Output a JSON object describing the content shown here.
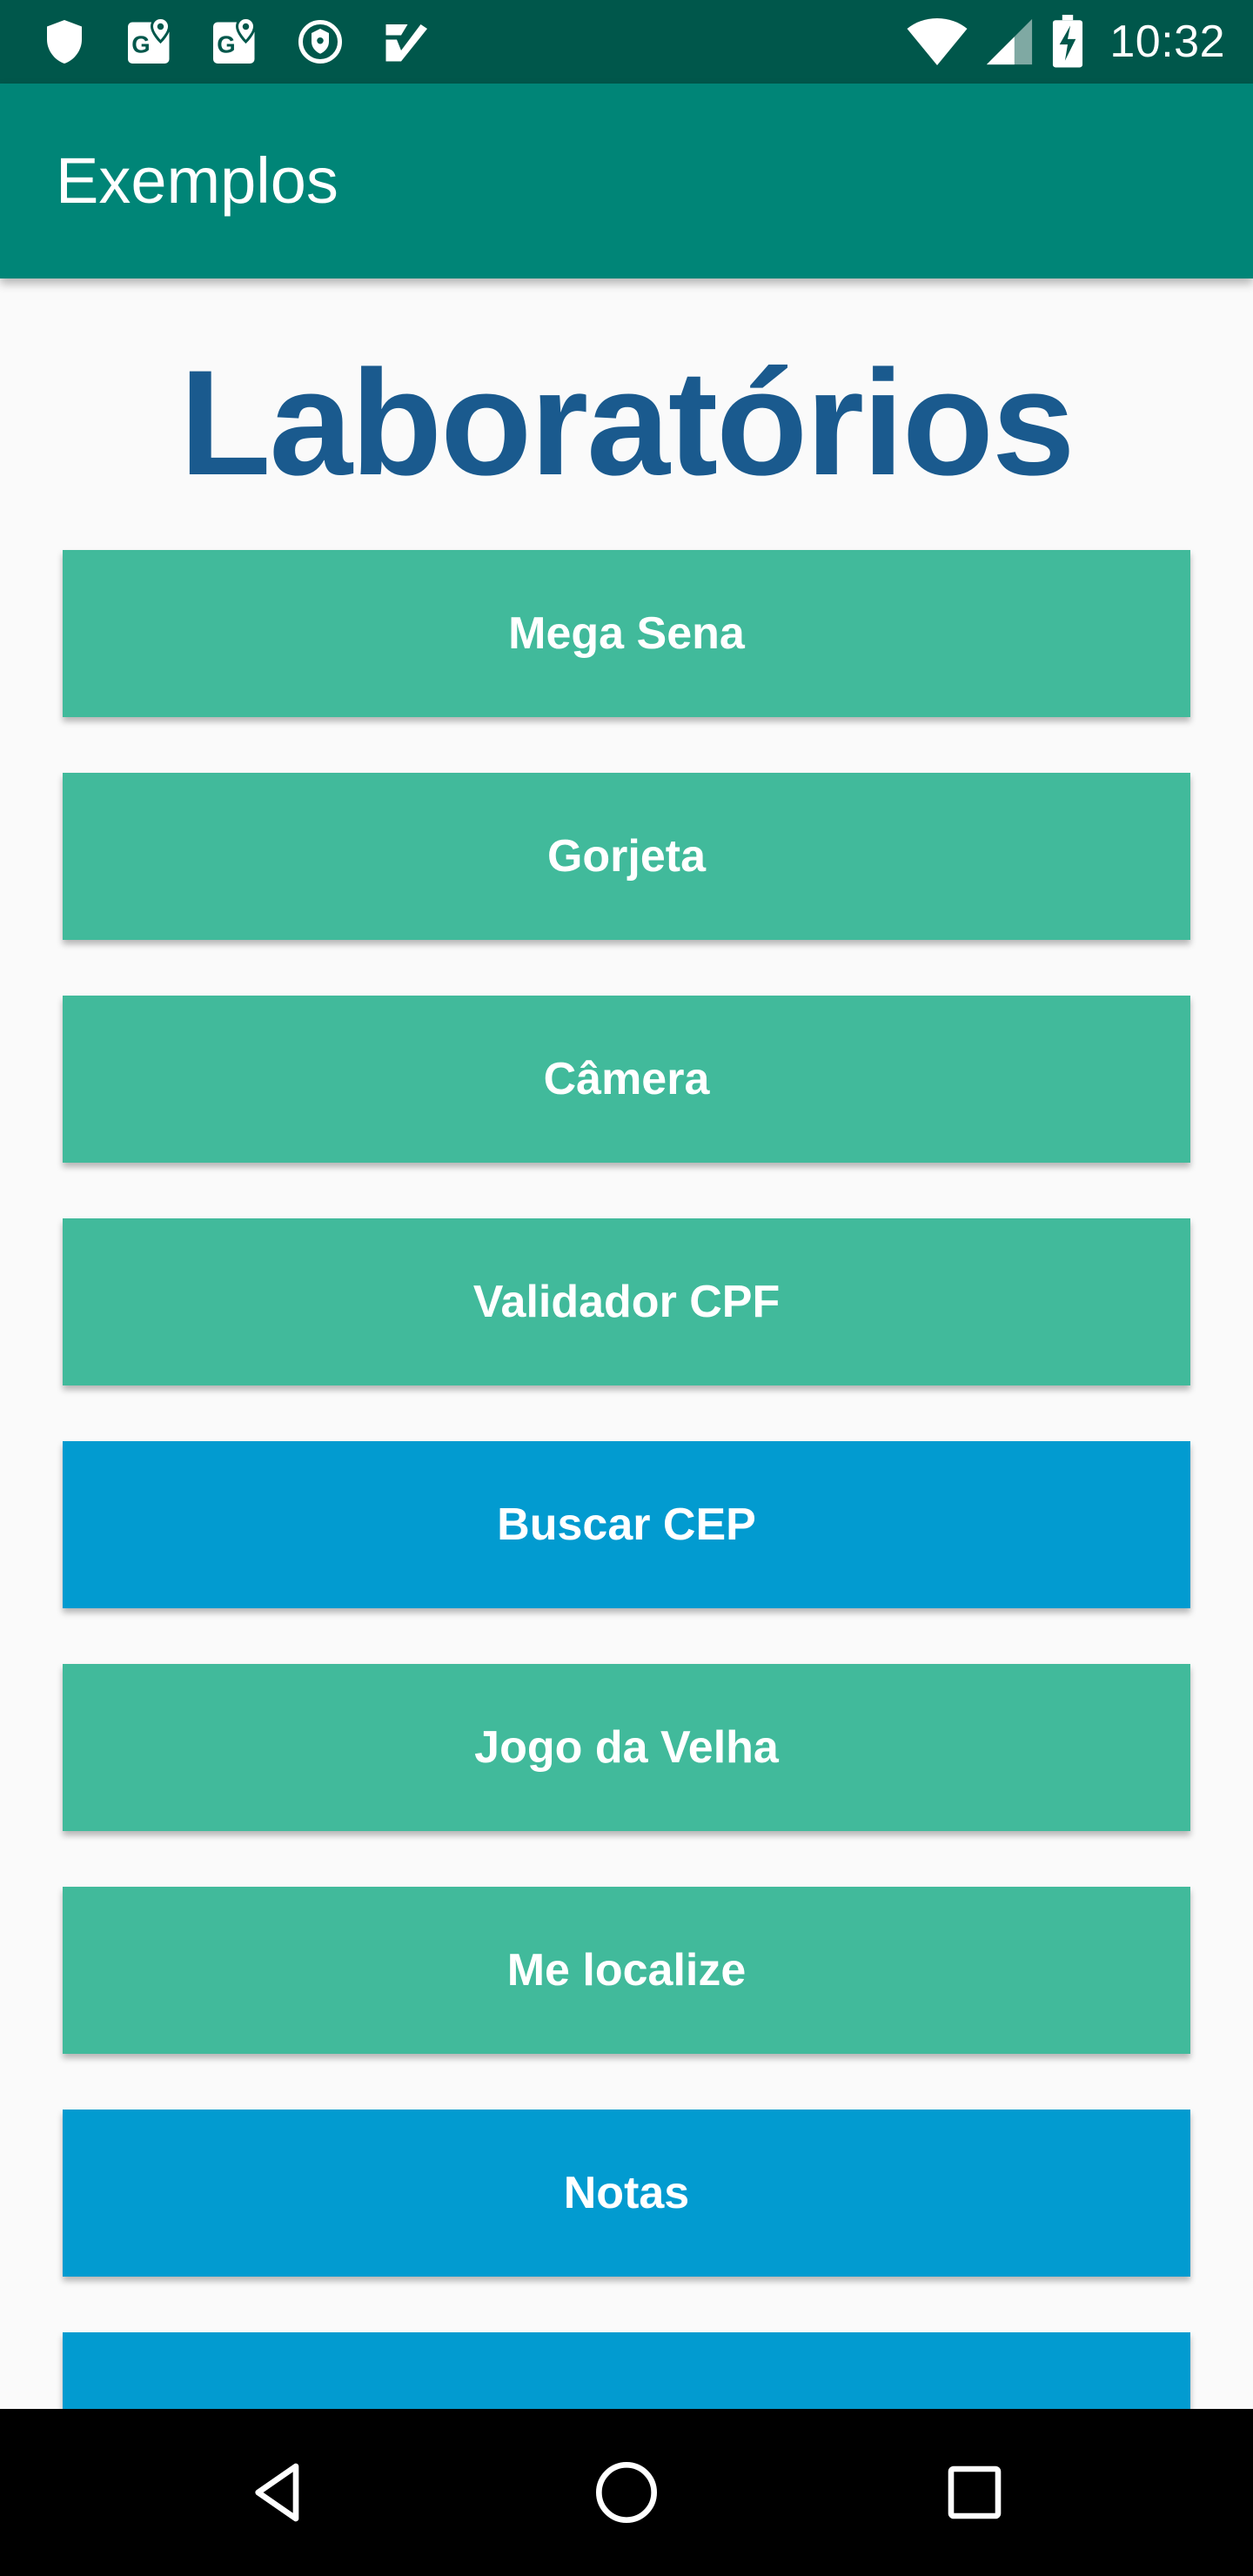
{
  "status_bar": {
    "time": "10:32",
    "left_icons": [
      "shield-icon",
      "maps-g-icon",
      "maps-g-icon",
      "vpn-shield-icon",
      "check-app-icon"
    ],
    "right_icons": [
      "wifi-icon",
      "cell-signal-icon",
      "battery-charging-icon"
    ]
  },
  "app_bar": {
    "title": "Exemplos",
    "color": "#008577"
  },
  "content": {
    "title": "Laboratórios",
    "title_color": "#1a5a8e",
    "buttons": [
      {
        "label": "Mega Sena",
        "color": "#41ba9b"
      },
      {
        "label": "Gorjeta",
        "color": "#41ba9b"
      },
      {
        "label": "Câmera",
        "color": "#41ba9b"
      },
      {
        "label": "Validador CPF",
        "color": "#41ba9b"
      },
      {
        "label": "Buscar CEP",
        "color": "#029bd0"
      },
      {
        "label": "Jogo da Velha",
        "color": "#41ba9b"
      },
      {
        "label": "Me localize",
        "color": "#41ba9b"
      },
      {
        "label": "Notas",
        "color": "#029bd0"
      },
      {
        "label": "",
        "color": "#029bd0"
      }
    ]
  },
  "nav_bar": {
    "buttons": [
      "back-icon",
      "home-icon",
      "recents-icon"
    ]
  }
}
